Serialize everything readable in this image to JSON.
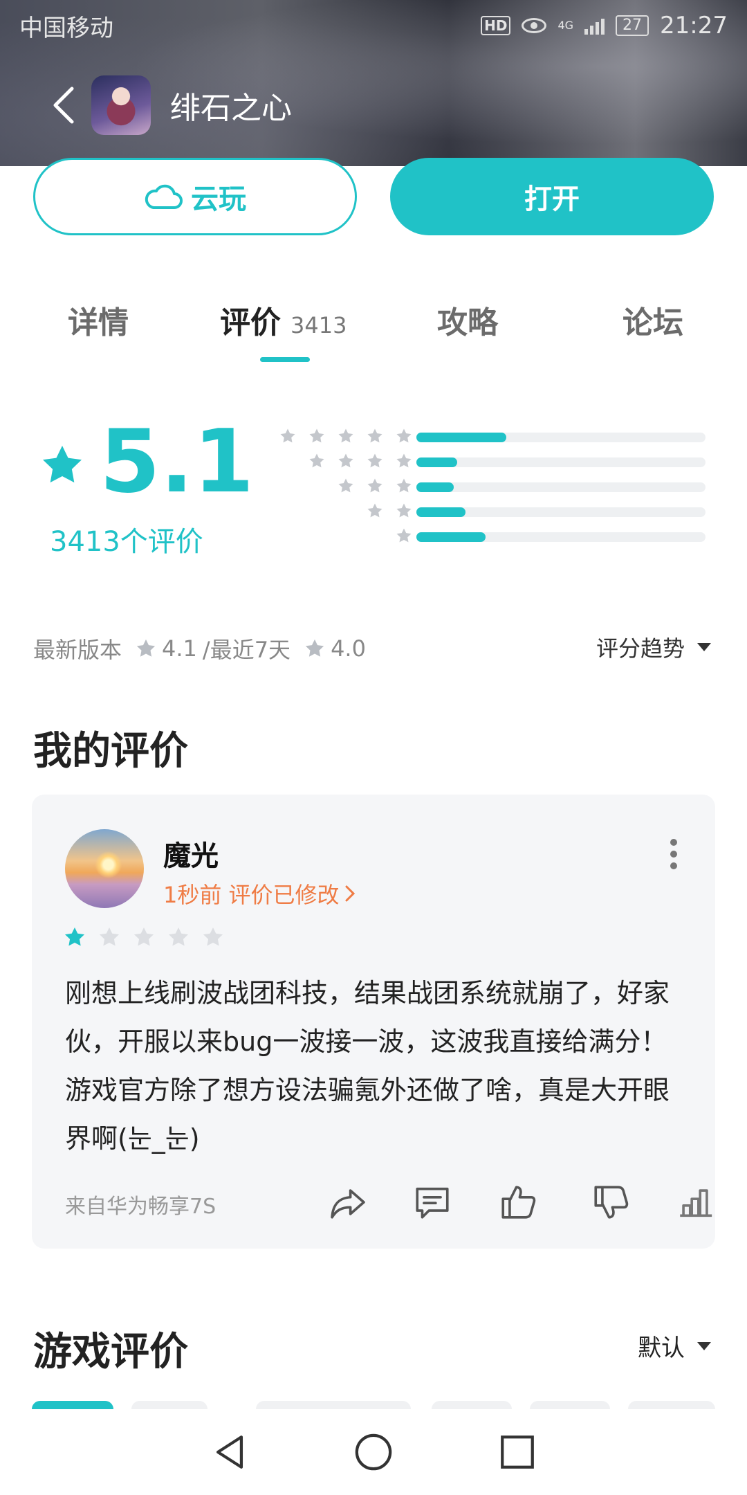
{
  "status_bar": {
    "carrier": "中国移动",
    "hd": "HD",
    "network": "4G",
    "battery": "27",
    "time": "21:27"
  },
  "header": {
    "title": "绯石之心"
  },
  "actions": {
    "cloud_play": "云玩",
    "open": "打开"
  },
  "tabs": [
    {
      "label": "详情",
      "count": ""
    },
    {
      "label": "评价",
      "count": "3413"
    },
    {
      "label": "攻略",
      "count": ""
    },
    {
      "label": "论坛",
      "count": ""
    }
  ],
  "rating": {
    "score": "5.1",
    "count_label": "3413个评价",
    "distribution": [
      {
        "stars": 5,
        "fraction": 0.31
      },
      {
        "stars": 4,
        "fraction": 0.14
      },
      {
        "stars": 3,
        "fraction": 0.13
      },
      {
        "stars": 2,
        "fraction": 0.17
      },
      {
        "stars": 1,
        "fraction": 0.24
      }
    ]
  },
  "version_line": {
    "latest_label": "最新版本",
    "latest_score": "4.1",
    "recent_label": "/最近7天",
    "recent_score": "4.0",
    "trend_label": "评分趋势"
  },
  "my_review": {
    "section_title": "我的评价",
    "username": "魔光",
    "meta": "1秒前 评价已修改",
    "stars": 1,
    "max_stars": 5,
    "text": "刚想上线刷波战团科技，结果战团系统就崩了，好家伙，开服以来bug一波接一波，这波我直接给满分！游戏官方除了想方设法骗氪外还做了啥，真是大开眼界啊(눈_눈)",
    "device": "来自华为畅享7S"
  },
  "game_reviews": {
    "section_title": "游戏评价",
    "sort_label": "默认"
  },
  "colors": {
    "accent": "#20c2c7",
    "meta": "#ef7c45"
  },
  "icons": [
    "back-arrow-icon",
    "cloud-icon",
    "star-icon",
    "more-vertical-icon",
    "share-icon",
    "comment-icon",
    "thumbs-up-icon",
    "thumbs-down-icon",
    "stats-icon",
    "nav-back-icon",
    "nav-home-icon",
    "nav-recent-icon"
  ]
}
